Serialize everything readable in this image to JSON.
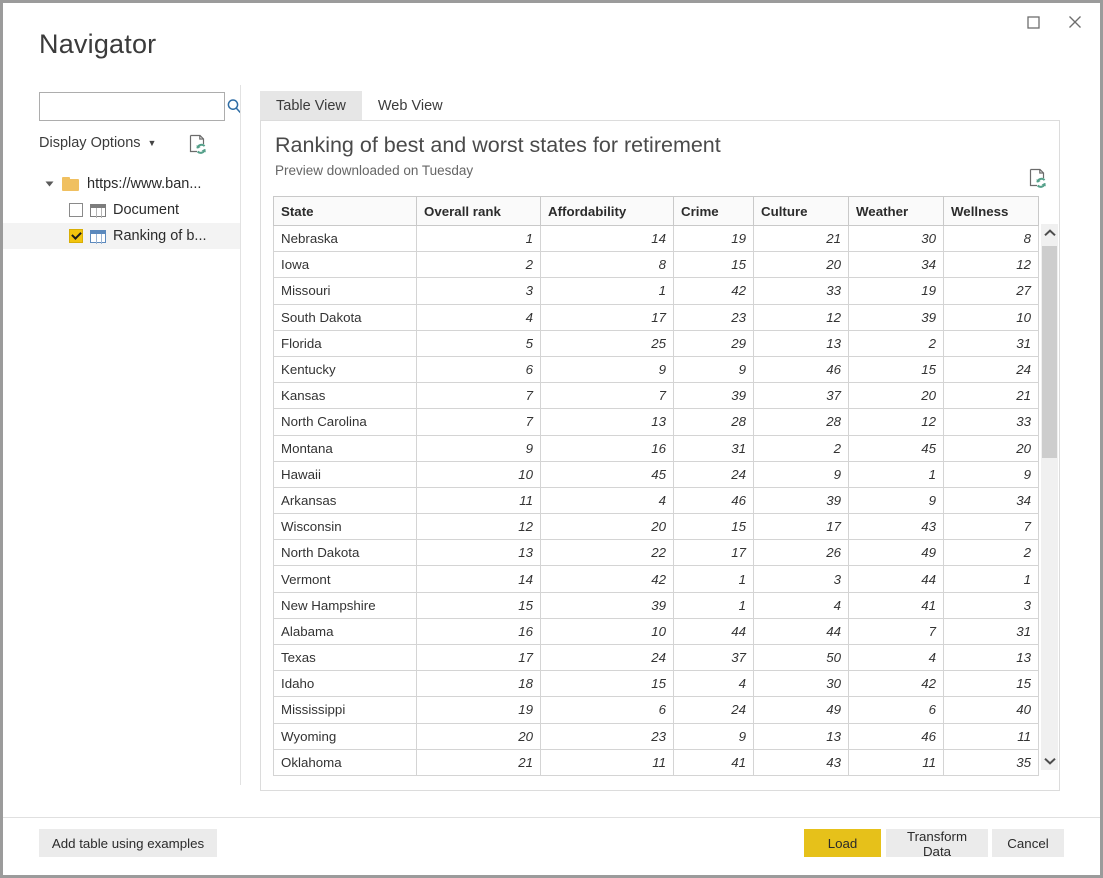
{
  "window": {
    "title": "Navigator",
    "maximize_label": "maximize-icon",
    "close_label": "close-icon"
  },
  "sidebar": {
    "search": {
      "value": "",
      "placeholder": "",
      "icon": "search-icon"
    },
    "display_options_label": "Display Options",
    "refresh_icon": "document-refresh-icon",
    "tree": {
      "root": {
        "label": "https://www.ban...",
        "expanded": true,
        "icon": "folder-icon"
      },
      "children": [
        {
          "label": "Document",
          "checked": false,
          "selected": false,
          "icon": "table-icon"
        },
        {
          "label": "Ranking of b...",
          "checked": true,
          "selected": true,
          "icon": "table-icon"
        }
      ]
    }
  },
  "main": {
    "tabs": [
      {
        "label": "Table View",
        "active": true
      },
      {
        "label": "Web View",
        "active": false
      }
    ],
    "doc_title": "Ranking of best and worst states for retirement",
    "doc_subtitle": "Preview downloaded on Tuesday",
    "refresh_icon": "document-refresh-icon",
    "scrollbar": {
      "up": "⌃",
      "down": "⌄"
    }
  },
  "footer": {
    "add_table_label": "Add table using examples",
    "load_label": "Load",
    "transform_label": "Transform Data",
    "cancel_label": "Cancel"
  },
  "colors": {
    "accent_yellow": "#e6c11a",
    "checkbox_yellow": "#f2c40e",
    "folder_orange": "#f0c060",
    "tab_active": "#e6e6e6",
    "border_gray": "#9b9b9b"
  },
  "table_data": {
    "type": "table",
    "columns": [
      "State",
      "Overall rank",
      "Affordability",
      "Crime",
      "Culture",
      "Weather",
      "Wellness"
    ],
    "rows": [
      [
        "Nebraska",
        "1",
        "14",
        "19",
        "21",
        "30",
        "8"
      ],
      [
        "Iowa",
        "2",
        "8",
        "15",
        "20",
        "34",
        "12"
      ],
      [
        "Missouri",
        "3",
        "1",
        "42",
        "33",
        "19",
        "27"
      ],
      [
        "South Dakota",
        "4",
        "17",
        "23",
        "12",
        "39",
        "10"
      ],
      [
        "Florida",
        "5",
        "25",
        "29",
        "13",
        "2",
        "31"
      ],
      [
        "Kentucky",
        "6",
        "9",
        "9",
        "46",
        "15",
        "24"
      ],
      [
        "Kansas",
        "7",
        "7",
        "39",
        "37",
        "20",
        "21"
      ],
      [
        "North Carolina",
        "7",
        "13",
        "28",
        "28",
        "12",
        "33"
      ],
      [
        "Montana",
        "9",
        "16",
        "31",
        "2",
        "45",
        "20"
      ],
      [
        "Hawaii",
        "10",
        "45",
        "24",
        "9",
        "1",
        "9"
      ],
      [
        "Arkansas",
        "11",
        "4",
        "46",
        "39",
        "9",
        "34"
      ],
      [
        "Wisconsin",
        "12",
        "20",
        "15",
        "17",
        "43",
        "7"
      ],
      [
        "North Dakota",
        "13",
        "22",
        "17",
        "26",
        "49",
        "2"
      ],
      [
        "Vermont",
        "14",
        "42",
        "1",
        "3",
        "44",
        "1"
      ],
      [
        "New Hampshire",
        "15",
        "39",
        "1",
        "4",
        "41",
        "3"
      ],
      [
        "Alabama",
        "16",
        "10",
        "44",
        "44",
        "7",
        "31"
      ],
      [
        "Texas",
        "17",
        "24",
        "37",
        "50",
        "4",
        "13"
      ],
      [
        "Idaho",
        "18",
        "15",
        "4",
        "30",
        "42",
        "15"
      ],
      [
        "Mississippi",
        "19",
        "6",
        "24",
        "49",
        "6",
        "40"
      ],
      [
        "Wyoming",
        "20",
        "23",
        "9",
        "13",
        "46",
        "11"
      ],
      [
        "Oklahoma",
        "21",
        "11",
        "41",
        "43",
        "11",
        "35"
      ]
    ]
  }
}
